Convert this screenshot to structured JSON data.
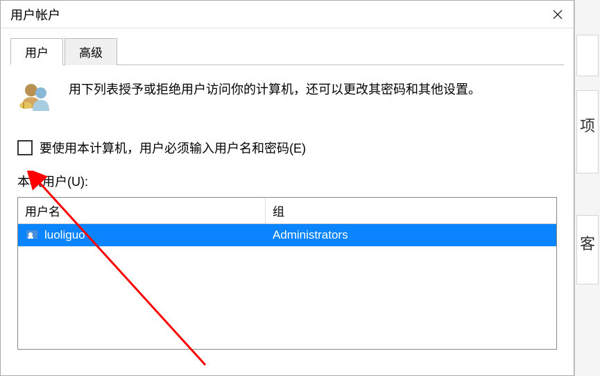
{
  "titlebar": {
    "title": "用户帐户"
  },
  "tabs": {
    "users": "用户",
    "advanced": "高级"
  },
  "info": {
    "text": "用下列表授予或拒绝用户访问你的计算机，还可以更改其密码和其他设置。"
  },
  "checkbox": {
    "label": "要使用本计算机，用户必须输入用户名和密码(E)",
    "checked": false
  },
  "listLabel": "本机用户(U):",
  "table": {
    "headers": {
      "name": "用户名",
      "group": "组"
    },
    "rows": [
      {
        "name": "luoliguo",
        "group": "Administrators",
        "selected": true
      }
    ]
  },
  "sideTexts": {
    "t1": "项",
    "t2": "客"
  }
}
